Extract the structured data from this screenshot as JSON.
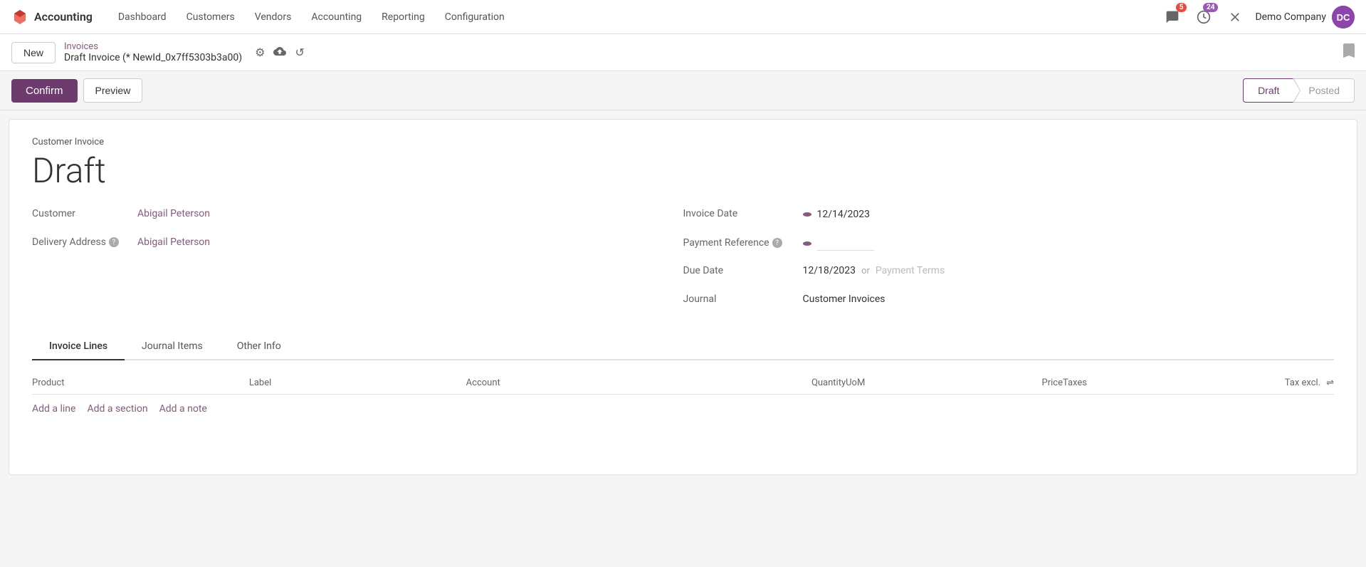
{
  "app": {
    "name": "Accounting",
    "logo_symbol": "✦"
  },
  "nav": {
    "items": [
      "Dashboard",
      "Customers",
      "Vendors",
      "Accounting",
      "Reporting",
      "Configuration"
    ],
    "notifications_count": "5",
    "clock_count": "24",
    "company": "Demo Company",
    "avatar_initials": "DC"
  },
  "toolbar": {
    "new_label": "New",
    "breadcrumb_link": "Invoices",
    "breadcrumb_title": "Draft Invoice (* NewId_0x7ff5303b3a00)",
    "bookmark_symbol": "🔖"
  },
  "actions": {
    "confirm_label": "Confirm",
    "preview_label": "Preview"
  },
  "status": {
    "draft_label": "Draft",
    "posted_label": "Posted"
  },
  "invoice": {
    "type_label": "Customer Invoice",
    "status_title": "Draft",
    "customer_label": "Customer",
    "customer_value": "Abigail Peterson",
    "delivery_address_label": "Delivery Address",
    "delivery_address_value": "Abigail Peterson",
    "invoice_date_label": "Invoice Date",
    "invoice_date_value": "12/14/2023",
    "payment_reference_label": "Payment Reference",
    "payment_reference_value": "",
    "due_date_label": "Due Date",
    "due_date_value": "12/18/2023",
    "or_text": "or",
    "payment_terms_placeholder": "Payment Terms",
    "journal_label": "Journal",
    "journal_value": "Customer Invoices"
  },
  "tabs": {
    "invoice_lines_label": "Invoice Lines",
    "journal_items_label": "Journal Items",
    "other_info_label": "Other Info"
  },
  "table": {
    "headers": {
      "product": "Product",
      "label": "Label",
      "account": "Account",
      "quantity": "Quantity",
      "uom": "UoM",
      "price": "Price",
      "taxes": "Taxes",
      "tax_excl": "Tax excl."
    }
  },
  "add_row": {
    "add_line_label": "Add a line",
    "add_section_label": "Add a section",
    "add_note_label": "Add a note"
  }
}
